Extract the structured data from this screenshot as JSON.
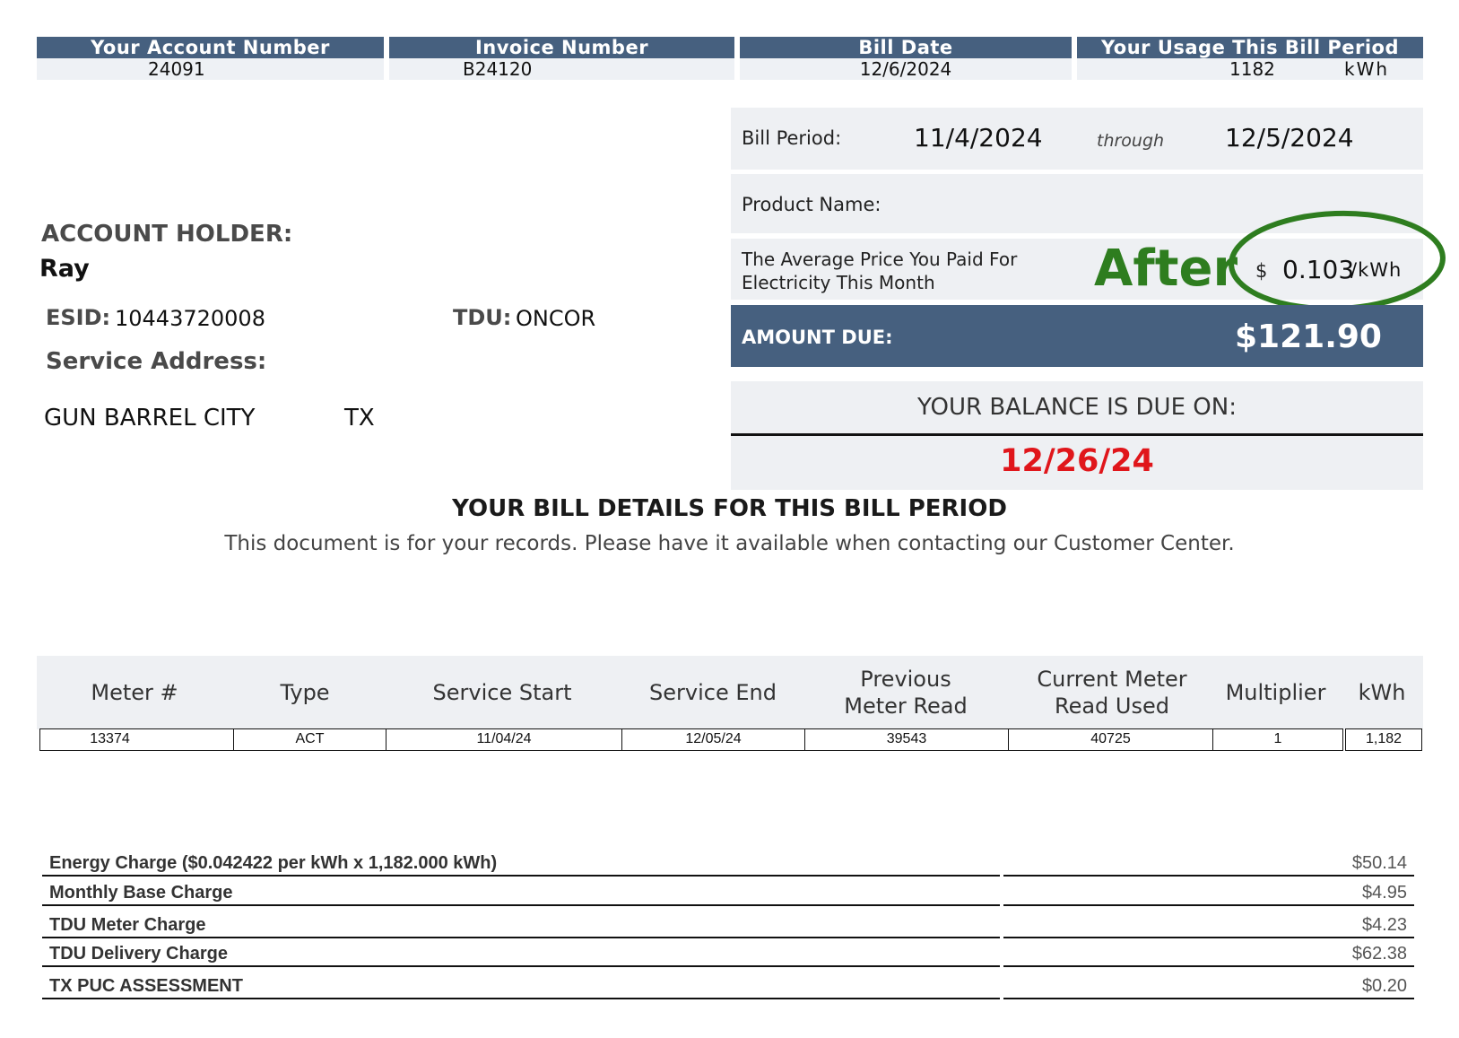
{
  "header": {
    "account_label": "Your Account Number",
    "account_value": "24091",
    "invoice_label": "Invoice Number",
    "invoice_value": "B24120",
    "billdate_label": "Bill Date",
    "billdate_value": "12/6/2024",
    "usage_label": "Your Usage This Bill Period",
    "usage_value": "1182",
    "usage_unit": "kWh"
  },
  "summary": {
    "bill_period_label": "Bill Period:",
    "period_start": "11/4/2024",
    "through": "through",
    "period_end": "12/5/2024",
    "product_label": "Product Name:",
    "avg_price_line1": "The Average Price You Paid For",
    "avg_price_line2": "Electricity This Month",
    "annotation": "After",
    "avg_price_currency": "$",
    "avg_price_value": "0.103",
    "avg_price_unit": "/kWh",
    "amount_due_label": "AMOUNT DUE:",
    "amount_due_value": "$121.90",
    "due_on_label": "YOUR BALANCE IS DUE ON:",
    "due_date": "12/26/24"
  },
  "account": {
    "holder_label": "ACCOUNT HOLDER:",
    "holder_name": "Ray",
    "esid_label": "ESID:",
    "esid_value": "10443720008",
    "tdu_label": "TDU:",
    "tdu_value": "ONCOR",
    "service_address_label": "Service Address:",
    "city": "GUN BARREL CITY",
    "state": "TX"
  },
  "details": {
    "title": "YOUR BILL DETAILS FOR THIS BILL PERIOD",
    "subtitle": "This document is for your records. Please have it available when contacting our Customer Center."
  },
  "meter_table": {
    "headers": [
      "Meter #",
      "Type",
      "Service Start",
      "Service End",
      "Previous Meter Read",
      "Current Meter Read Used",
      "Multiplier",
      "kWh"
    ],
    "row": [
      "13374",
      "ACT",
      "11/04/24",
      "12/05/24",
      "39543",
      "40725",
      "1",
      "1,182"
    ]
  },
  "charges": [
    {
      "label": "Energy Charge ($0.042422 per kWh x 1,182.000 kWh)",
      "amount": "$50.14"
    },
    {
      "label": "Monthly Base Charge",
      "amount": "$4.95"
    },
    {
      "label": "TDU Meter Charge",
      "amount": "$4.23"
    },
    {
      "label": "TDU Delivery Charge",
      "amount": "$62.38"
    },
    {
      "label": "TX PUC ASSESSMENT",
      "amount": "$0.20"
    }
  ],
  "colors": {
    "header_blue": "#46607f",
    "due_red": "#e0161b",
    "annotation_green": "#2e7d1f"
  }
}
